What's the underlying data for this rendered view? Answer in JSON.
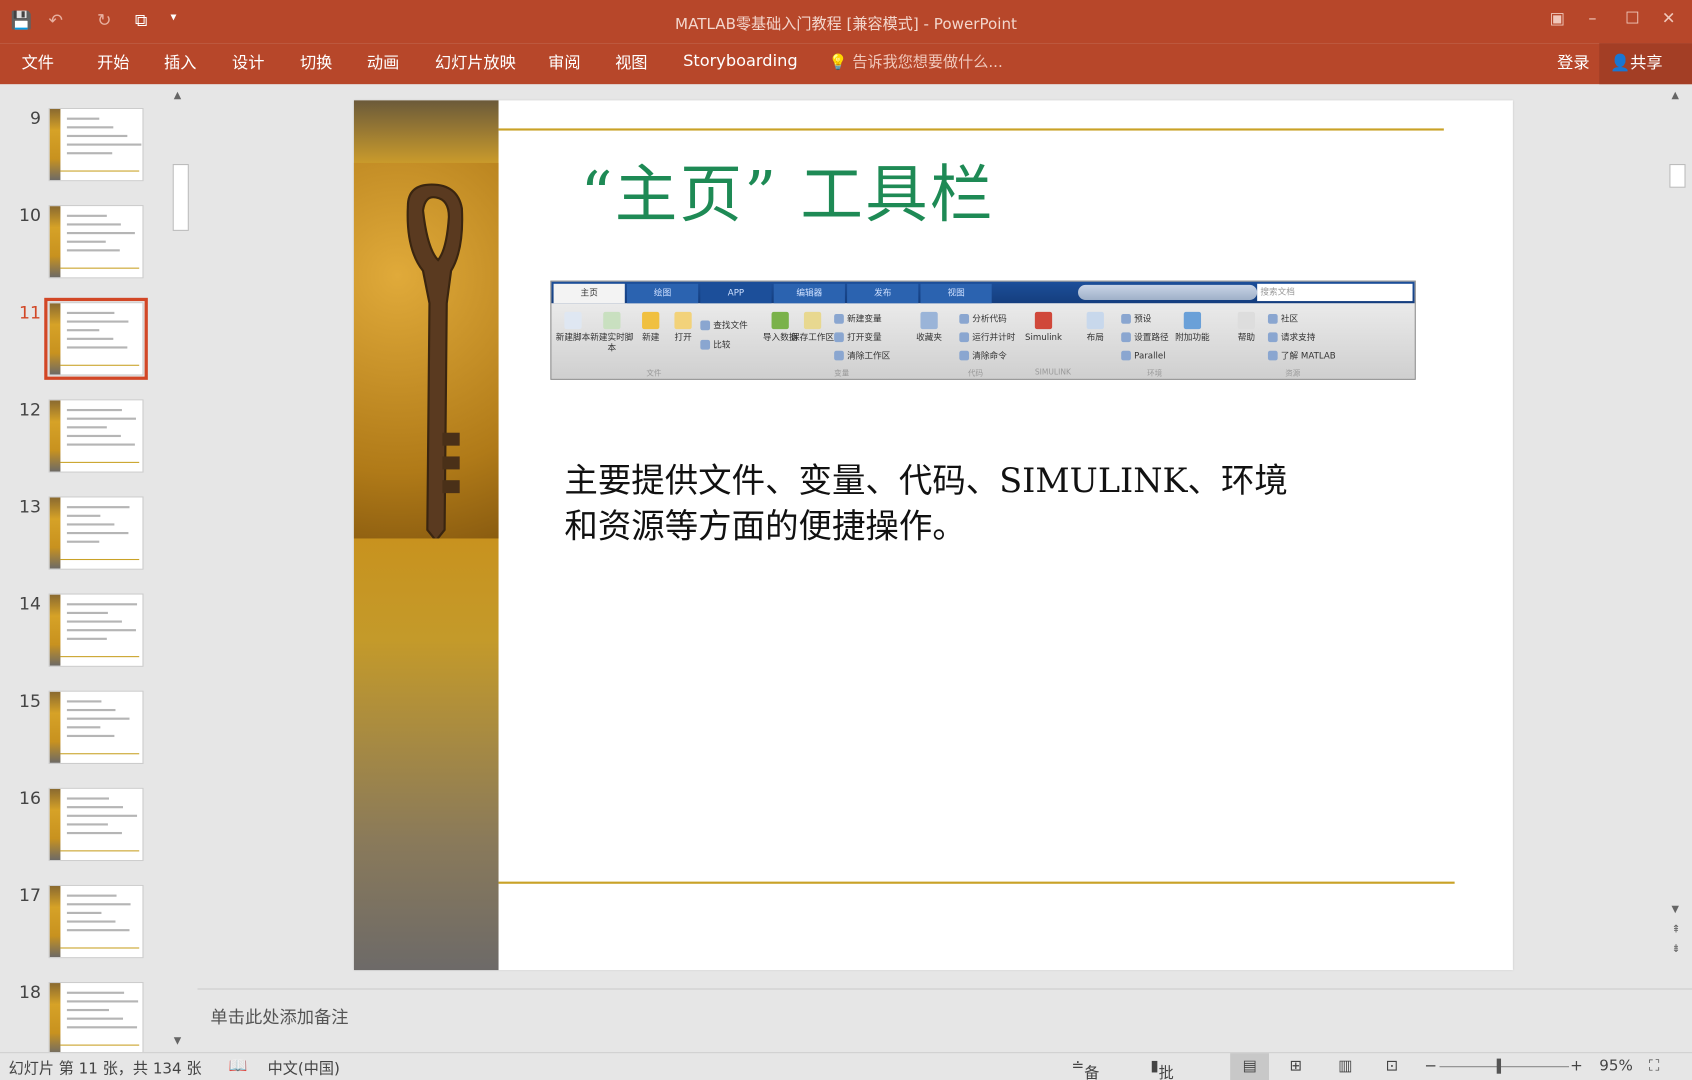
{
  "app": {
    "title": "MATLAB零基础入门教程 [兼容模式] - PowerPoint",
    "accent": "#b7472a"
  },
  "ribbon": {
    "tabs": [
      "文件",
      "开始",
      "插入",
      "设计",
      "切换",
      "动画",
      "幻灯片放映",
      "审阅",
      "视图",
      "Storyboarding"
    ],
    "tell_me": "告诉我您想要做什么...",
    "login": "登录",
    "share": "共享"
  },
  "thumbnails": {
    "numbers": [
      "9",
      "10",
      "11",
      "12",
      "13",
      "14",
      "15",
      "16",
      "17",
      "18"
    ],
    "selected": "11"
  },
  "slide": {
    "title": "“主页” 工具栏",
    "title_color": "#1e8a55",
    "body": [
      "主要提供文件、变量、代码、SIMULINK、环境",
      "和资源等方面的便捷操作。"
    ],
    "matlab_toolstrip": {
      "tabs": [
        "主页",
        "绘图",
        "APP",
        "编辑器",
        "发布",
        "视图"
      ],
      "search_placeholder": "搜索文档",
      "buttons": [
        "新建脚本",
        "新建实时脚本",
        "新建",
        "打开",
        "导入数据",
        "保存工作区",
        "收藏夹",
        "Simulink",
        "布局",
        "附加功能",
        "帮助"
      ],
      "small_buttons": [
        "查找文件",
        "比较",
        "新建变量",
        "打开变量",
        "清除工作区",
        "分析代码",
        "运行并计时",
        "清除命令",
        "预设",
        "设置路径",
        "Parallel",
        "社区",
        "请求支持",
        "了解 MATLAB"
      ],
      "sections": [
        "文件",
        "变量",
        "代码",
        "SIMULINK",
        "环境",
        "资源"
      ]
    }
  },
  "notes": {
    "placeholder": "单击此处添加备注"
  },
  "status": {
    "slide_info": "幻灯片 第 11 张，共 134 张",
    "language": "中文(中国)",
    "notes": "备注",
    "comments": "批注",
    "zoom": "95%"
  }
}
